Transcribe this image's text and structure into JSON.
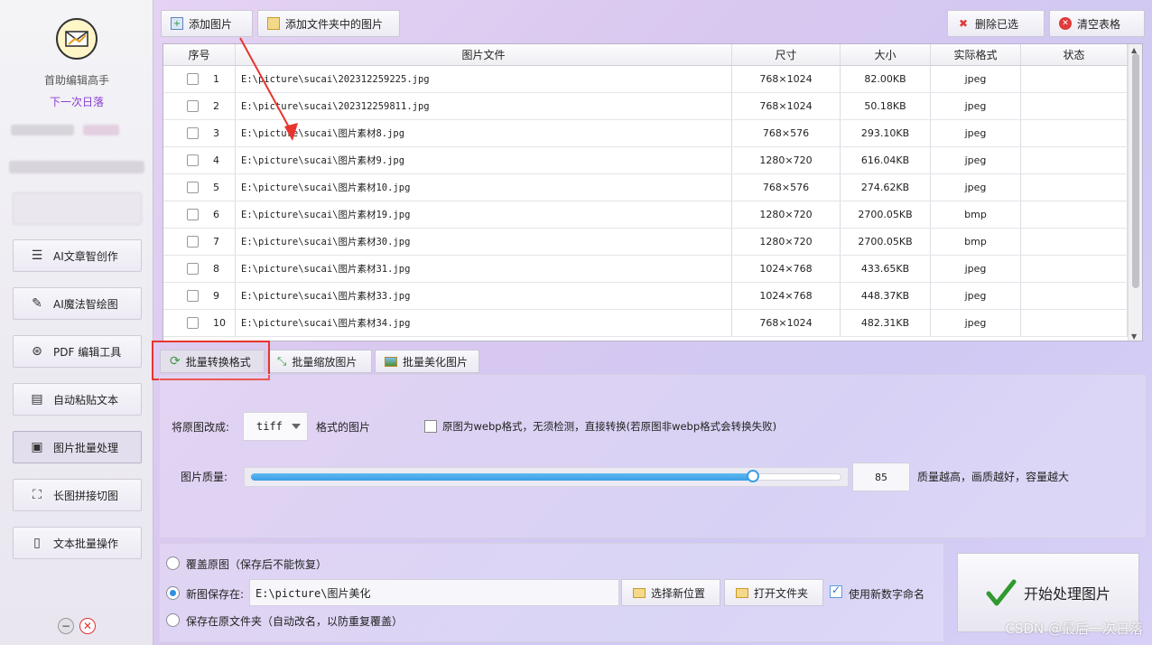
{
  "sidebar": {
    "app_name": "首助编辑高手",
    "user_name": "下一次日落",
    "nav": [
      {
        "label": "AI文章智创作",
        "icon": "list-icon"
      },
      {
        "label": "AI魔法智绘图",
        "icon": "brush-icon"
      },
      {
        "label": "PDF 编辑工具",
        "icon": "pdf-icon"
      },
      {
        "label": "自动粘贴文本",
        "icon": "paste-icon"
      },
      {
        "label": "图片批量处理",
        "icon": "image-icon",
        "active": true
      },
      {
        "label": "长图拼接切图",
        "icon": "crop-icon"
      },
      {
        "label": "文本批量操作",
        "icon": "text-icon"
      }
    ]
  },
  "toolbar": {
    "add_image": "添加图片",
    "add_folder": "添加文件夹中的图片",
    "delete_selected": "删除已选",
    "clear_table": "清空表格"
  },
  "table": {
    "headers": [
      "序号",
      "图片文件",
      "尺寸",
      "大小",
      "实际格式",
      "状态"
    ],
    "rows": [
      {
        "no": "1",
        "file": "E:\\picture\\sucai\\202312259225.jpg",
        "size": "768×1024",
        "bytes": "82.00KB",
        "fmt": "jpeg",
        "status": ""
      },
      {
        "no": "2",
        "file": "E:\\picture\\sucai\\202312259811.jpg",
        "size": "768×1024",
        "bytes": "50.18KB",
        "fmt": "jpeg",
        "status": ""
      },
      {
        "no": "3",
        "file": "E:\\picture\\sucai\\图片素材8.jpg",
        "size": "768×576",
        "bytes": "293.10KB",
        "fmt": "jpeg",
        "status": ""
      },
      {
        "no": "4",
        "file": "E:\\picture\\sucai\\图片素材9.jpg",
        "size": "1280×720",
        "bytes": "616.04KB",
        "fmt": "jpeg",
        "status": ""
      },
      {
        "no": "5",
        "file": "E:\\picture\\sucai\\图片素材10.jpg",
        "size": "768×576",
        "bytes": "274.62KB",
        "fmt": "jpeg",
        "status": ""
      },
      {
        "no": "6",
        "file": "E:\\picture\\sucai\\图片素材19.jpg",
        "size": "1280×720",
        "bytes": "2700.05KB",
        "fmt": "bmp",
        "status": ""
      },
      {
        "no": "7",
        "file": "E:\\picture\\sucai\\图片素材30.jpg",
        "size": "1280×720",
        "bytes": "2700.05KB",
        "fmt": "bmp",
        "status": ""
      },
      {
        "no": "8",
        "file": "E:\\picture\\sucai\\图片素材31.jpg",
        "size": "1024×768",
        "bytes": "433.65KB",
        "fmt": "jpeg",
        "status": ""
      },
      {
        "no": "9",
        "file": "E:\\picture\\sucai\\图片素材33.jpg",
        "size": "1024×768",
        "bytes": "448.37KB",
        "fmt": "jpeg",
        "status": ""
      },
      {
        "no": "10",
        "file": "E:\\picture\\sucai\\图片素材34.jpg",
        "size": "768×1024",
        "bytes": "482.31KB",
        "fmt": "jpeg",
        "status": ""
      }
    ]
  },
  "tabs": {
    "convert": "批量转换格式",
    "resize": "批量缩放图片",
    "beautify": "批量美化图片"
  },
  "options": {
    "convert_label": "将原图改成:",
    "format_value": "tiff",
    "format_suffix": "格式的图片",
    "webp_label": "原图为webp格式，无须检测，直接转换(若原图非webp格式会转换失败)",
    "quality_label": "图片质量:",
    "quality_value": "85",
    "quality_hint": "质量越高，画质越好，容量越大"
  },
  "output": {
    "overwrite": "覆盖原图（保存后不能恢复）",
    "save_new_label": "新图保存在:",
    "save_path": "E:\\picture\\图片美化",
    "choose_location": "选择新位置",
    "open_folder": "打开文件夹",
    "numeric_name": "使用新数字命名",
    "save_in_source": "保存在原文件夹（自动改名，以防重复覆盖）",
    "start": "开始处理图片"
  },
  "watermark": "CSDN @最后一次日落",
  "colors": {
    "accent": "#3a9ee5",
    "highlight_box": "#e8342d",
    "user_name": "#8a3fd1"
  }
}
